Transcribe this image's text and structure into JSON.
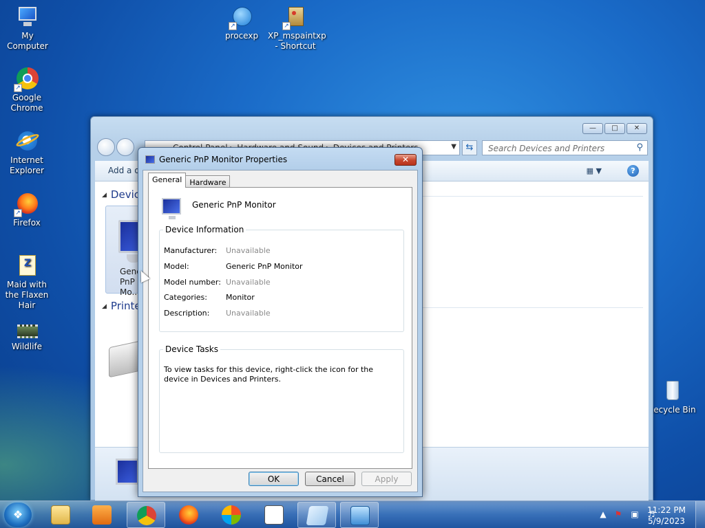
{
  "desktop": {
    "icons": [
      {
        "label": "My Computer",
        "icon": "computer-icon"
      },
      {
        "label": "procexp",
        "icon": "process-explorer-icon"
      },
      {
        "label": "XP_mspaintxp - Shortcut",
        "icon": "paint-icon"
      },
      {
        "label": "Google Chrome",
        "icon": "chrome-icon"
      },
      {
        "label": "Internet Explorer",
        "icon": "ie-icon"
      },
      {
        "label": "Firefox",
        "icon": "firefox-icon"
      },
      {
        "label": "Maid with the Flaxen Hair",
        "icon": "audio-file-icon"
      },
      {
        "label": "Wildlife",
        "icon": "video-file-icon"
      },
      {
        "label": "Recycle Bin",
        "icon": "recycle-bin-icon"
      }
    ]
  },
  "explorer": {
    "breadcrumb": "Control Panel  ▸  Hardware and Sound  ▸  Devices and Printers",
    "search_placeholder": "Search Devices and Printers",
    "toolbar_add": "Add a device",
    "groups": [
      {
        "label": "Devices"
      },
      {
        "label": "Printers"
      }
    ],
    "device_tile_label": "Generic PnP Mo..."
  },
  "dialog": {
    "title": "Generic PnP Monitor Properties",
    "tabs": [
      {
        "label": "General",
        "active": true
      },
      {
        "label": "Hardware",
        "active": false
      }
    ],
    "device_name": "Generic PnP Monitor",
    "device_info": {
      "legend": "Device Information",
      "rows": [
        {
          "label": "Manufacturer:",
          "value": "Unavailable",
          "muted": true
        },
        {
          "label": "Model:",
          "value": "Generic PnP Monitor",
          "muted": false
        },
        {
          "label": "Model number:",
          "value": "Unavailable",
          "muted": true
        },
        {
          "label": "Categories:",
          "value": "Monitor",
          "muted": false
        },
        {
          "label": "Description:",
          "value": "Unavailable",
          "muted": true
        }
      ]
    },
    "device_tasks": {
      "legend": "Device Tasks",
      "text": "To view tasks for this device, right-click the icon for the device in Devices and Printers."
    },
    "buttons": {
      "ok": "OK",
      "cancel": "Cancel",
      "apply": "Apply"
    }
  },
  "taskbar": {
    "clock_time": "11:22 PM",
    "clock_date": "5/9/2023"
  },
  "colors": {
    "desktop_blue": "#1a6bc8",
    "accent": "#1e3b8c",
    "close_red": "#c6442c"
  }
}
